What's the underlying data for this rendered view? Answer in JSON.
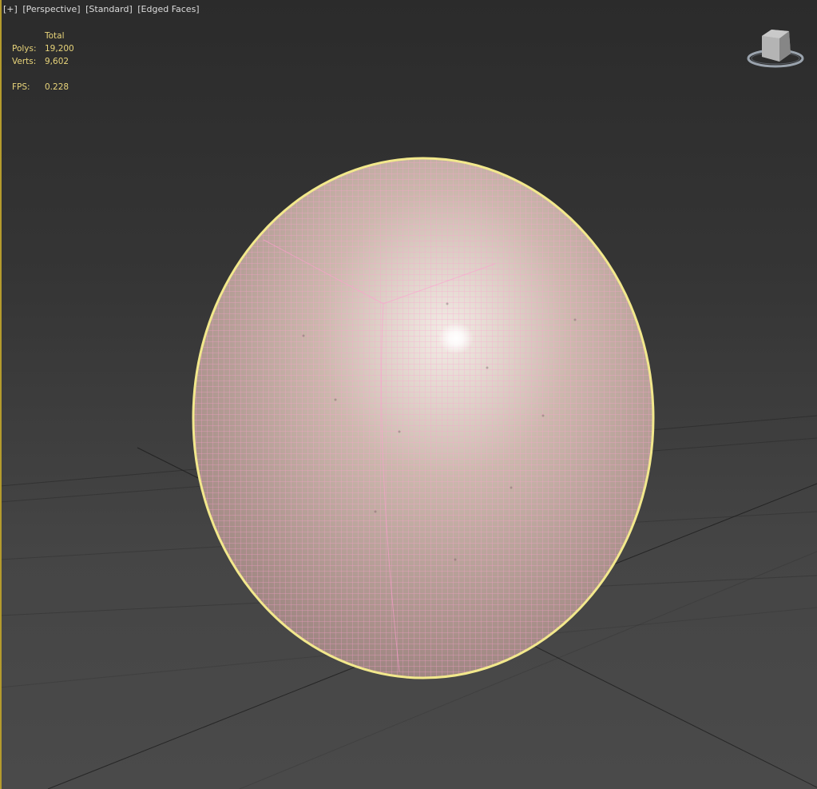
{
  "viewport": {
    "labels": {
      "menu": "[+]",
      "view": "[Perspective]",
      "shading": "[Standard]",
      "display": "[Edged Faces]"
    },
    "stats": {
      "header": "Total",
      "polys_label": "Polys:",
      "polys_value": "19,200",
      "verts_label": "Verts:",
      "verts_value": "9,602",
      "fps_label": "FPS:",
      "fps_value": "0.228"
    },
    "viewcube": {
      "icon": "viewcube-icon"
    },
    "object": {
      "name": "sphere-object",
      "selection_color": "#f2e88c",
      "wire_color": "#ff9fd0",
      "surface_color": "#c6afa3"
    },
    "grid_color": "#151515",
    "border_color": "#b49b2d"
  }
}
